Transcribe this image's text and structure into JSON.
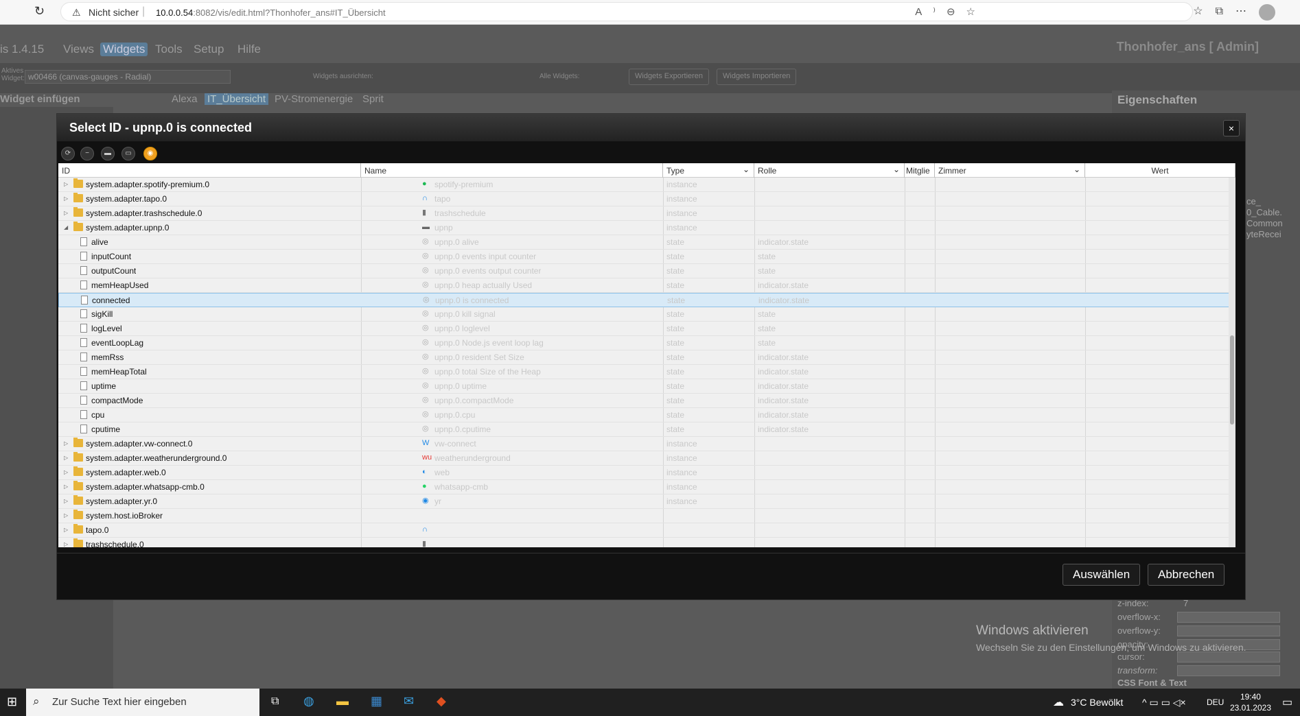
{
  "browser": {
    "security": "Nicht sicher",
    "url_host": "10.0.0.54",
    "url_rest": ":8082/vis/edit.html?Thonhofer_ans#IT_Übersicht"
  },
  "app": {
    "version": "is 1.4.15",
    "menu": [
      "Views",
      "Widgets",
      "Tools",
      "Setup",
      "Hilfe"
    ],
    "user": "Thonhofer_ans [ Admin]",
    "active_widget_label": "Aktives Widget:",
    "active_widget": "w00466 (canvas-gauges - Radial)",
    "align_label": "Widgets ausrichten:",
    "all_widgets_label": "Alle Widgets:",
    "export": "Widgets Exportieren",
    "import": "Widgets Importieren",
    "insert_widget": "Widget einfügen",
    "tabs": [
      "Alexa",
      "IT_Übersicht",
      "PV-Stromenergie",
      "Sprit"
    ],
    "properties": "Eigenschaften",
    "rp_labels": [
      "z-index:",
      "overflow-x:",
      "overflow-y:",
      "opacity:",
      "cursor:",
      "transform:",
      "CSS Font & Text"
    ],
    "rp_zindex": "7",
    "rp_side": [
      "ce_",
      "0_Cable.",
      "Common",
      "yteRecei"
    ]
  },
  "watermark": {
    "title": "Windows aktivieren",
    "sub": "Wechseln Sie zu den Einstellungen, um Windows zu aktivieren."
  },
  "dialog": {
    "title": "Select ID - upnp.0 is connected",
    "close": "×",
    "columns": [
      "ID",
      "Name",
      "Type",
      "Rolle",
      "Mitglie",
      "Zimmer",
      "Wert"
    ],
    "rows": [
      {
        "id": "system.adapter.spotify-premium.0",
        "name": "spotify-premium",
        "type": "instance",
        "role": "",
        "level": 0,
        "kind": "folder",
        "icon": "●",
        "icolor": "#1db954"
      },
      {
        "id": "system.adapter.tapo.0",
        "name": "tapo",
        "type": "instance",
        "role": "",
        "level": 0,
        "kind": "folder",
        "icon": "∩",
        "icolor": "#1e88e5"
      },
      {
        "id": "system.adapter.trashschedule.0",
        "name": "trashschedule",
        "type": "instance",
        "role": "",
        "level": 0,
        "kind": "folder",
        "icon": "▮",
        "icolor": "#777"
      },
      {
        "id": "system.adapter.upnp.0",
        "name": "upnp",
        "type": "instance",
        "role": "",
        "level": 0,
        "kind": "open",
        "icon": "▬",
        "icolor": "#666"
      },
      {
        "id": "alive",
        "name": "upnp.0 alive",
        "type": "state",
        "role": "indicator.state",
        "level": 1,
        "kind": "file",
        "icon": "◎",
        "icolor": "#aaa"
      },
      {
        "id": "inputCount",
        "name": "upnp.0 events input counter",
        "type": "state",
        "role": "state",
        "level": 1,
        "kind": "file",
        "icon": "◎",
        "icolor": "#aaa"
      },
      {
        "id": "outputCount",
        "name": "upnp.0 events output counter",
        "type": "state",
        "role": "state",
        "level": 1,
        "kind": "file",
        "icon": "◎",
        "icolor": "#aaa"
      },
      {
        "id": "memHeapUsed",
        "name": "upnp.0 heap actually Used",
        "type": "state",
        "role": "indicator.state",
        "level": 1,
        "kind": "file",
        "icon": "◎",
        "icolor": "#aaa"
      },
      {
        "id": "connected",
        "name": "upnp.0 is connected",
        "type": "state",
        "role": "indicator.state",
        "level": 1,
        "kind": "file",
        "icon": "◎",
        "icolor": "#aaa",
        "selected": true
      },
      {
        "id": "sigKill",
        "name": "upnp.0 kill signal",
        "type": "state",
        "role": "state",
        "level": 1,
        "kind": "file",
        "icon": "◎",
        "icolor": "#aaa"
      },
      {
        "id": "logLevel",
        "name": "upnp.0 loglevel",
        "type": "state",
        "role": "state",
        "level": 1,
        "kind": "file",
        "icon": "◎",
        "icolor": "#aaa"
      },
      {
        "id": "eventLoopLag",
        "name": "upnp.0 Node.js event loop lag",
        "type": "state",
        "role": "state",
        "level": 1,
        "kind": "file",
        "icon": "◎",
        "icolor": "#aaa"
      },
      {
        "id": "memRss",
        "name": "upnp.0 resident Set Size",
        "type": "state",
        "role": "indicator.state",
        "level": 1,
        "kind": "file",
        "icon": "◎",
        "icolor": "#aaa"
      },
      {
        "id": "memHeapTotal",
        "name": "upnp.0 total Size of the Heap",
        "type": "state",
        "role": "indicator.state",
        "level": 1,
        "kind": "file",
        "icon": "◎",
        "icolor": "#aaa"
      },
      {
        "id": "uptime",
        "name": "upnp.0 uptime",
        "type": "state",
        "role": "indicator.state",
        "level": 1,
        "kind": "file",
        "icon": "◎",
        "icolor": "#aaa"
      },
      {
        "id": "compactMode",
        "name": "upnp.0.compactMode",
        "type": "state",
        "role": "indicator.state",
        "level": 1,
        "kind": "file",
        "icon": "◎",
        "icolor": "#aaa"
      },
      {
        "id": "cpu",
        "name": "upnp.0.cpu",
        "type": "state",
        "role": "indicator.state",
        "level": 1,
        "kind": "file",
        "icon": "◎",
        "icolor": "#aaa"
      },
      {
        "id": "cputime",
        "name": "upnp.0.cputime",
        "type": "state",
        "role": "indicator.state",
        "level": 1,
        "kind": "file",
        "icon": "◎",
        "icolor": "#aaa"
      },
      {
        "id": "system.adapter.vw-connect.0",
        "name": "vw-connect",
        "type": "instance",
        "role": "",
        "level": 0,
        "kind": "folder",
        "icon": "W",
        "icolor": "#1e88e5"
      },
      {
        "id": "system.adapter.weatherunderground.0",
        "name": "weatherunderground",
        "type": "instance",
        "role": "",
        "level": 0,
        "kind": "folder",
        "icon": "wu",
        "icolor": "#e53935"
      },
      {
        "id": "system.adapter.web.0",
        "name": "web",
        "type": "instance",
        "role": "",
        "level": 0,
        "kind": "folder",
        "icon": "◐",
        "icolor": "#1e88e5"
      },
      {
        "id": "system.adapter.whatsapp-cmb.0",
        "name": "whatsapp-cmb",
        "type": "instance",
        "role": "",
        "level": 0,
        "kind": "folder",
        "icon": "●",
        "icolor": "#25d366"
      },
      {
        "id": "system.adapter.yr.0",
        "name": "yr",
        "type": "instance",
        "role": "",
        "level": 0,
        "kind": "folder",
        "icon": "◉",
        "icolor": "#1e88e5"
      },
      {
        "id": "system.host.ioBroker",
        "name": "",
        "type": "",
        "role": "",
        "level": 0,
        "kind": "folder",
        "icon": "",
        "icolor": "#000"
      },
      {
        "id": "tapo.0",
        "name": "",
        "type": "",
        "role": "",
        "level": 0,
        "kind": "folder",
        "icon": "∩",
        "icolor": "#1e88e5"
      },
      {
        "id": "trashschedule.0",
        "name": "",
        "type": "",
        "role": "",
        "level": 0,
        "kind": "folder",
        "icon": "▮",
        "icolor": "#777"
      }
    ],
    "select_btn": "Auswählen",
    "cancel_btn": "Abbrechen"
  },
  "taskbar": {
    "search_placeholder": "Zur Suche Text hier eingeben",
    "weather": "3°C Bewölkt",
    "lang": "DEU",
    "time": "19:40",
    "date": "23.01.2023"
  }
}
